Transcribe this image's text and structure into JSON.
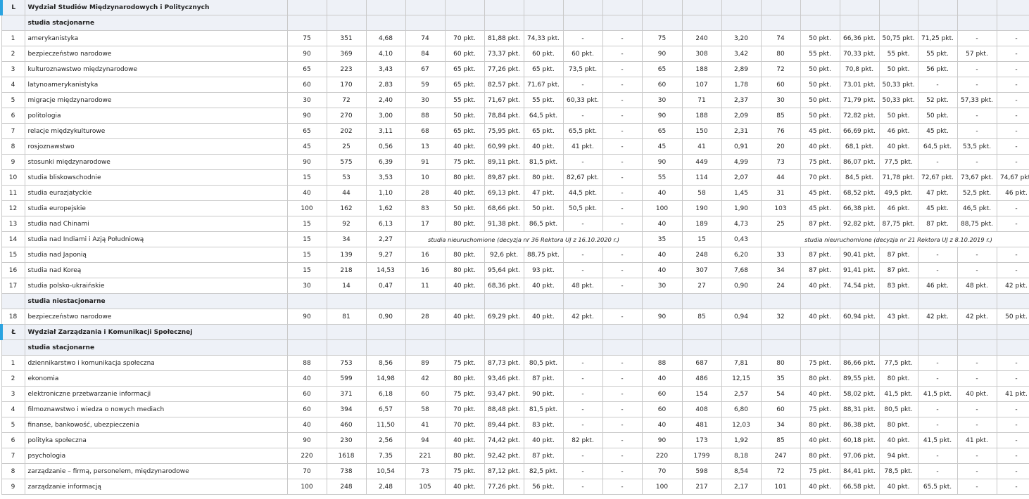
{
  "sections": [
    {
      "letter": "L",
      "title": "Wydział Studiów Międzynarodowych i Politycznych",
      "groups": [
        {
          "subtitle": "studia stacjonarne",
          "rows": [
            [
              "1",
              "amerykanistyka",
              "75",
              "351",
              "4,68",
              "74",
              "70 pkt.",
              "81,88 pkt.",
              "74,33 pkt.",
              "-",
              "-",
              "75",
              "240",
              "3,20",
              "74",
              "50 pkt.",
              "66,36 pkt.",
              "50,75 pkt.",
              "71,25 pkt.",
              "-",
              "-"
            ],
            [
              "2",
              "bezpieczeństwo narodowe",
              "90",
              "369",
              "4,10",
              "84",
              "60 pkt.",
              "73,37 pkt.",
              "60 pkt.",
              "60 pkt.",
              "-",
              "90",
              "308",
              "3,42",
              "80",
              "55 pkt.",
              "70,33 pkt.",
              "55 pkt.",
              "55 pkt.",
              "57 pkt.",
              "-"
            ],
            [
              "3",
              "kulturoznawstwo międzynarodowe",
              "65",
              "223",
              "3,43",
              "67",
              "65 pkt.",
              "77,26 pkt.",
              "65 pkt.",
              "73,5 pkt.",
              "-",
              "65",
              "188",
              "2,89",
              "72",
              "50 pkt.",
              "70,8 pkt.",
              "50 pkt.",
              "56 pkt.",
              "-",
              "-"
            ],
            [
              "4",
              "latynoamerykanistyka",
              "60",
              "170",
              "2,83",
              "59",
              "65 pkt.",
              "82,57 pkt.",
              "71,67 pkt.",
              "-",
              "-",
              "60",
              "107",
              "1,78",
              "60",
              "50 pkt.",
              "73,01 pkt.",
              "50,33 pkt.",
              "-",
              "-",
              "-"
            ],
            [
              "5",
              "migracje międzynarodowe",
              "30",
              "72",
              "2,40",
              "30",
              "55 pkt.",
              "71,67 pkt.",
              "55 pkt.",
              "60,33 pkt.",
              "-",
              "30",
              "71",
              "2,37",
              "30",
              "50 pkt.",
              "71,79 pkt.",
              "50,33 pkt.",
              "52 pkt.",
              "57,33 pkt.",
              "-"
            ],
            [
              "6",
              "politologia",
              "90",
              "270",
              "3,00",
              "88",
              "50 pkt.",
              "78,84 pkt.",
              "64,5 pkt.",
              "-",
              "-",
              "90",
              "188",
              "2,09",
              "85",
              "50 pkt.",
              "72,82 pkt.",
              "50 pkt.",
              "50 pkt.",
              "-",
              "-"
            ],
            [
              "7",
              "relacje międzykulturowe",
              "65",
              "202",
              "3,11",
              "68",
              "65 pkt.",
              "75,95 pkt.",
              "65 pkt.",
              "65,5 pkt.",
              "-",
              "65",
              "150",
              "2,31",
              "76",
              "45 pkt.",
              "66,69 pkt.",
              "46 pkt.",
              "45 pkt.",
              "-",
              "-"
            ],
            [
              "8",
              "rosjoznawstwo",
              "45",
              "25",
              "0,56",
              "13",
              "40 pkt.",
              "60,99 pkt.",
              "40 pkt.",
              "41 pkt.",
              "-",
              "45",
              "41",
              "0,91",
              "20",
              "40 pkt.",
              "68,1 pkt.",
              "40 pkt.",
              "64,5 pkt.",
              "53,5 pkt.",
              "-"
            ],
            [
              "9",
              "stosunki międzynarodowe",
              "90",
              "575",
              "6,39",
              "91",
              "75 pkt.",
              "89,11 pkt.",
              "81,5 pkt.",
              "-",
              "-",
              "90",
              "449",
              "4,99",
              "73",
              "75 pkt.",
              "86,07 pkt.",
              "77,5 pkt.",
              "-",
              "-",
              "-"
            ],
            [
              "10",
              "studia bliskowschodnie",
              "15",
              "53",
              "3,53",
              "10",
              "80 pkt.",
              "89,87 pkt.",
              "80 pkt.",
              "82,67 pkt.",
              "-",
              "55",
              "114",
              "2,07",
              "44",
              "70 pkt.",
              "84,5 pkt.",
              "71,78 pkt.",
              "72,67 pkt.",
              "73,67 pkt.",
              "74,67 pkt."
            ],
            [
              "11",
              "studia eurazjatyckie",
              "40",
              "44",
              "1,10",
              "28",
              "40 pkt.",
              "69,13 pkt.",
              "47 pkt.",
              "44,5 pkt.",
              "-",
              "40",
              "58",
              "1,45",
              "31",
              "45 pkt.",
              "68,52 pkt.",
              "49,5 pkt.",
              "47 pkt.",
              "52,5 pkt.",
              "46 pkt."
            ],
            [
              "12",
              "studia europejskie",
              "100",
              "162",
              "1,62",
              "83",
              "50 pkt.",
              "68,66 pkt.",
              "50 pkt.",
              "50,5 pkt.",
              "-",
              "100",
              "190",
              "1,90",
              "103",
              "45 pkt.",
              "66,38 pkt.",
              "46 pkt.",
              "45 pkt.",
              "46,5 pkt.",
              "-"
            ],
            [
              "13",
              "studia nad Chinami",
              "15",
              "92",
              "6,13",
              "17",
              "80 pkt.",
              "91,38 pkt.",
              "86,5 pkt.",
              "-",
              "-",
              "40",
              "189",
              "4,73",
              "25",
              "87 pkt.",
              "92,82 pkt.",
              "87,75 pkt.",
              "87 pkt.",
              "88,75 pkt.",
              "-"
            ],
            {
              "special": true,
              "cells": [
                "14",
                "studia nad Indiami i Azją Południową",
                "15",
                "34",
                "2,27"
              ],
              "note1": "studia nieuruchomione (decyzja nr 36 Rektora UJ z 16.10.2020 r.)",
              "mid": [
                "35",
                "15",
                "0,43"
              ],
              "note2": "studia nieuruchomione (decyzja nr 21 Rektora UJ z 8.10.2019 r.)"
            },
            [
              "15",
              "studia nad Japonią",
              "15",
              "139",
              "9,27",
              "16",
              "80 pkt.",
              "92,6 pkt.",
              "88,75 pkt.",
              "-",
              "-",
              "40",
              "248",
              "6,20",
              "33",
              "87 pkt.",
              "90,41 pkt.",
              "87 pkt.",
              "-",
              "-",
              "-"
            ],
            [
              "16",
              "studia nad Koreą",
              "15",
              "218",
              "14,53",
              "16",
              "80 pkt.",
              "95,64 pkt.",
              "93 pkt.",
              "-",
              "-",
              "40",
              "307",
              "7,68",
              "34",
              "87 pkt.",
              "91,41 pkt.",
              "87 pkt.",
              "-",
              "-",
              "-"
            ],
            [
              "17",
              "studia polsko-ukraińskie",
              "30",
              "14",
              "0,47",
              "11",
              "40 pkt.",
              "68,36 pkt.",
              "40 pkt.",
              "48 pkt.",
              "-",
              "30",
              "27",
              "0,90",
              "24",
              "40 pkt.",
              "74,54 pkt.",
              "83 pkt.",
              "46 pkt.",
              "48 pkt.",
              "42 pkt."
            ]
          ]
        },
        {
          "subtitle": "studia niestacjonarne",
          "rows": [
            [
              "18",
              "bezpieczeństwo narodowe",
              "90",
              "81",
              "0,90",
              "28",
              "40 pkt.",
              "69,29 pkt.",
              "40 pkt.",
              "42 pkt.",
              "-",
              "90",
              "85",
              "0,94",
              "32",
              "40 pkt.",
              "60,94 pkt.",
              "43 pkt.",
              "42 pkt.",
              "42 pkt.",
              "50 pkt."
            ]
          ]
        }
      ]
    },
    {
      "letter": "Ł",
      "title": "Wydział Zarządzania i Komunikacji Społecznej",
      "groups": [
        {
          "subtitle": "studia stacjonarne",
          "rows": [
            [
              "1",
              "dziennikarstwo i komunikacja społeczna",
              "88",
              "753",
              "8,56",
              "89",
              "75 pkt.",
              "87,73 pkt.",
              "80,5 pkt.",
              "-",
              "-",
              "88",
              "687",
              "7,81",
              "80",
              "75 pkt.",
              "86,66 pkt.",
              "77,5 pkt.",
              "-",
              "-",
              "-"
            ],
            [
              "2",
              "ekonomia",
              "40",
              "599",
              "14,98",
              "42",
              "80 pkt.",
              "93,46 pkt.",
              "87 pkt.",
              "-",
              "-",
              "40",
              "486",
              "12,15",
              "35",
              "80 pkt.",
              "89,55 pkt.",
              "80 pkt.",
              "-",
              "-",
              "-"
            ],
            [
              "3",
              "elektroniczne przetwarzanie informacji",
              "60",
              "371",
              "6,18",
              "60",
              "75 pkt.",
              "93,47 pkt.",
              "90 pkt.",
              "-",
              "-",
              "60",
              "154",
              "2,57",
              "54",
              "40 pkt.",
              "58,02 pkt.",
              "41,5 pkt.",
              "41,5 pkt.",
              "40 pkt.",
              "41 pkt."
            ],
            [
              "4",
              "filmoznawstwo i wiedza o nowych mediach",
              "60",
              "394",
              "6,57",
              "58",
              "70 pkt.",
              "88,48 pkt.",
              "81,5 pkt.",
              "-",
              "-",
              "60",
              "408",
              "6,80",
              "60",
              "75 pkt.",
              "88,31 pkt.",
              "80,5 pkt.",
              "-",
              "-",
              "-"
            ],
            [
              "5",
              "finanse, bankowość, ubezpieczenia",
              "40",
              "460",
              "11,50",
              "41",
              "70 pkt.",
              "89,44 pkt.",
              "83 pkt.",
              "-",
              "-",
              "40",
              "481",
              "12,03",
              "34",
              "80 pkt.",
              "86,38 pkt.",
              "80 pkt.",
              "-",
              "-",
              "-"
            ],
            [
              "6",
              "polityka społeczna",
              "90",
              "230",
              "2,56",
              "94",
              "40 pkt.",
              "74,42 pkt.",
              "40 pkt.",
              "82 pkt.",
              "-",
              "90",
              "173",
              "1,92",
              "85",
              "40 pkt.",
              "60,18 pkt.",
              "40 pkt.",
              "41,5 pkt.",
              "41 pkt.",
              "-"
            ],
            [
              "7",
              "psychologia",
              "220",
              "1618",
              "7,35",
              "221",
              "80 pkt.",
              "92,42 pkt.",
              "87 pkt.",
              "-",
              "-",
              "220",
              "1799",
              "8,18",
              "247",
              "80 pkt.",
              "97,06 pkt.",
              "94 pkt.",
              "-",
              "-",
              "-"
            ],
            [
              "8",
              "zarządzanie – firmą, personelem, międzynarodowe",
              "70",
              "738",
              "10,54",
              "73",
              "75 pkt.",
              "87,12 pkt.",
              "82,5 pkt.",
              "-",
              "-",
              "70",
              "598",
              "8,54",
              "72",
              "75 pkt.",
              "84,41 pkt.",
              "78,5 pkt.",
              "-",
              "-",
              "-"
            ],
            [
              "9",
              "zarządzanie informacją",
              "100",
              "248",
              "2,48",
              "105",
              "40 pkt.",
              "77,26 pkt.",
              "56 pkt.",
              "-",
              "-",
              "100",
              "217",
              "2,17",
              "101",
              "40 pkt.",
              "66,58 pkt.",
              "40 pkt.",
              "65,5 pkt.",
              "-",
              "-"
            ]
          ]
        }
      ]
    }
  ]
}
